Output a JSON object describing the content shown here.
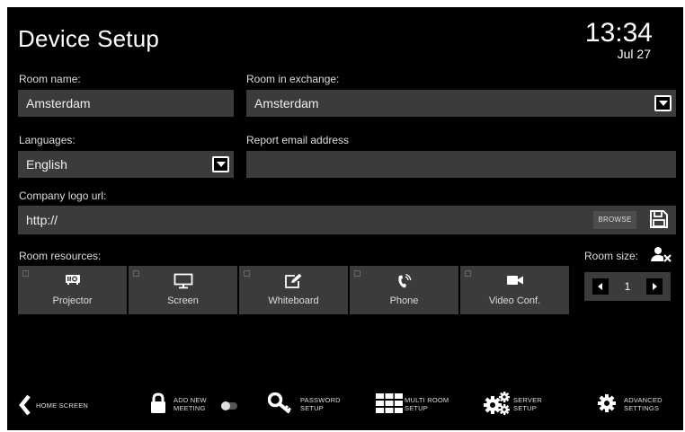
{
  "header": {
    "title": "Device Setup",
    "time": "13:34",
    "date": "Jul 27"
  },
  "form": {
    "room_name": {
      "label": "Room name:",
      "value": "Amsterdam"
    },
    "room_exchange": {
      "label": "Room in exchange:",
      "value": "Amsterdam"
    },
    "languages": {
      "label": "Languages:",
      "value": "English"
    },
    "report_email": {
      "label": "Report email address",
      "value": ""
    },
    "company_logo": {
      "label": "Company logo url:",
      "value": "http://",
      "browse_label": "BROWSE"
    }
  },
  "resources": {
    "label": "Room resources:",
    "items": [
      {
        "label": "Projector",
        "icon": "projector-icon"
      },
      {
        "label": "Screen",
        "icon": "monitor-icon"
      },
      {
        "label": "Whiteboard",
        "icon": "whiteboard-icon"
      },
      {
        "label": "Phone",
        "icon": "phone-icon"
      },
      {
        "label": "Video Conf.",
        "icon": "video-camera-icon"
      }
    ]
  },
  "room_size": {
    "label": "Room size:",
    "value": "1"
  },
  "bottom_nav": {
    "home": "HOME SCREEN",
    "add_meeting_1": "ADD NEW",
    "add_meeting_2": "MEETING",
    "password_1": "PASSWORD",
    "password_2": "SETUP",
    "multiroom_1": "MULTI ROOM",
    "multiroom_2": "SETUP",
    "server_1": "SERVER",
    "server_2": "SETUP",
    "advanced_1": "ADVANCED",
    "advanced_2": "SETTINGS"
  },
  "colors": {
    "background": "#000000",
    "field": "#3b3b3b",
    "text": "#ffffff"
  }
}
